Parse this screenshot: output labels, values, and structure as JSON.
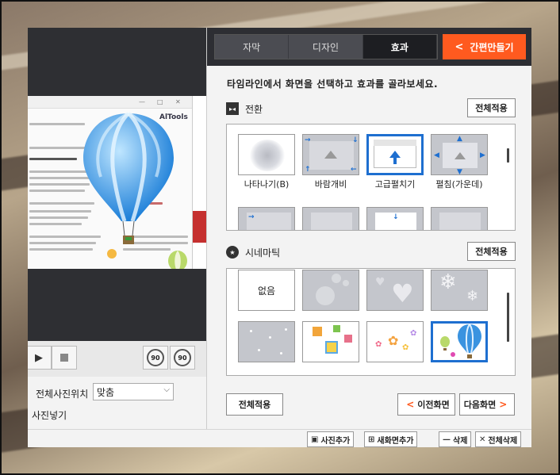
{
  "tabs": [
    {
      "label": "자막",
      "active": false
    },
    {
      "label": "디자인",
      "active": false
    },
    {
      "label": "효과",
      "active": true
    }
  ],
  "quick_button": {
    "label": "간편만들기",
    "icon": "chevron-left-icon"
  },
  "instruction": "타임라인에서 화면을 선택하고 효과를 골라보세요.",
  "transition": {
    "title": "전환",
    "apply_label": "전체적용",
    "effects": [
      {
        "label": "나타나기(B)",
        "selected": false
      },
      {
        "label": "바람개비",
        "selected": false
      },
      {
        "label": "고급펼치기",
        "selected": true
      },
      {
        "label": "펼침(가운데)",
        "selected": false
      }
    ]
  },
  "cinematic": {
    "title": "시네마틱",
    "apply_label": "전체적용",
    "effects": [
      {
        "label": "없음",
        "selected": false
      },
      {
        "label": "",
        "selected": false
      },
      {
        "label": "",
        "selected": false
      },
      {
        "label": "",
        "selected": false
      },
      {
        "label": "",
        "selected": false
      },
      {
        "label": "",
        "selected": false
      },
      {
        "label": "",
        "selected": false
      },
      {
        "label": "",
        "selected": true
      }
    ]
  },
  "footer": {
    "apply_all_label": "전체적용",
    "prev_label": "이전화면",
    "next_label": "다음화면"
  },
  "left_panel": {
    "rotate_left_label": "90",
    "rotate_right_label": "90",
    "position_label": "전체사진위치",
    "position_value": "맞춤",
    "add_photo_label": "사진넣기",
    "preview_tools_text": "AlTools"
  },
  "statusbar": {
    "add_photo": "사진추가",
    "add_screen": "새화면추가",
    "delete": "삭제",
    "delete_all": "전체삭제"
  },
  "colors": {
    "accent": "#ff5a1f",
    "selection": "#1e6fd0",
    "topbar": "#2d2e33"
  }
}
